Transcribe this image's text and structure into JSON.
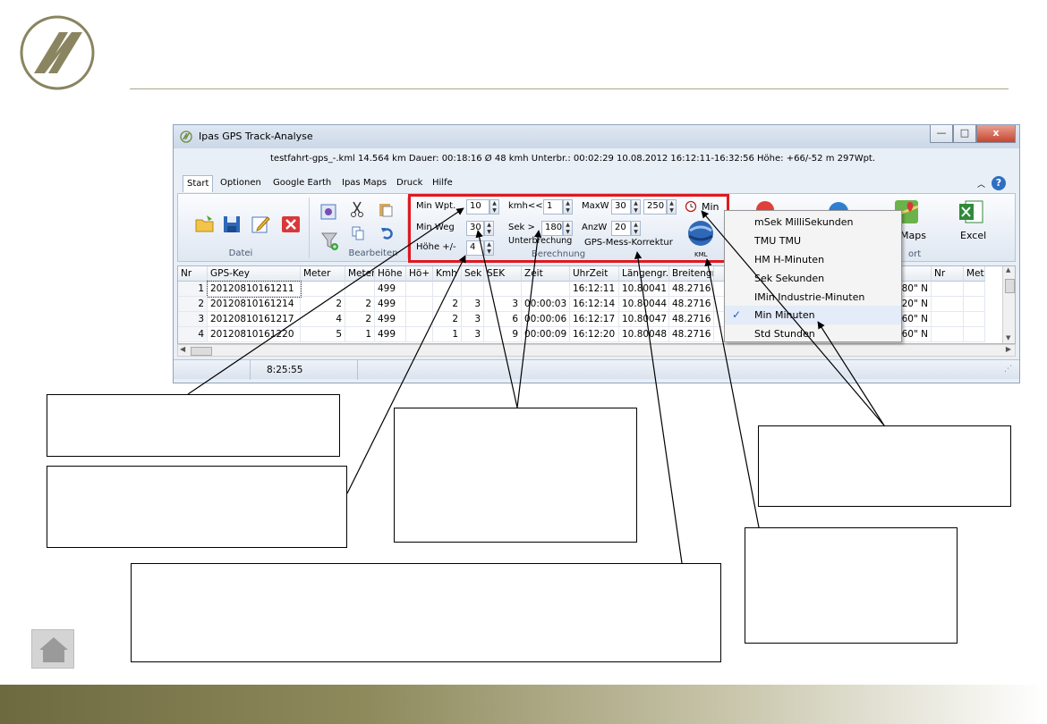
{
  "window": {
    "title": "Ipas GPS Track-Analyse",
    "info": "testfahrt-gps_-.kml 14.564 km  Dauer: 00:18:16  Ø 48 kmh  Unterbr.: 00:02:29  10.08.2012 16:12:11-16:32:56   Höhe: +66/-52 m  297Wpt.",
    "minimize": "—",
    "maximize": "□",
    "close": "x"
  },
  "tabs": [
    "Start",
    "Optionen",
    "Google Earth",
    "Ipas Maps",
    "Druck",
    "Hilfe"
  ],
  "ribbon": {
    "datei_label": "Datei",
    "bearbeiten_label": "Bearbeiten",
    "berechnung_label": "Berechnung",
    "export_label": "ort",
    "kml_label": "KML",
    "maps_label": "Maps",
    "excel_label": "Excel",
    "min_wpt_label": "Min Wpt.",
    "min_wpt_value": "10",
    "min_weg_label": "Min Weg",
    "min_weg_value": "30",
    "hoehe_label": "Höhe +/-",
    "hoehe_value": "4",
    "kmh_label": "kmh<<",
    "kmh_value": "1",
    "sek_label": "Sek >",
    "sek_value": "180",
    "unterbrechung_label": "Unterbrechung",
    "maxw_label": "MaxW",
    "maxw_value1": "30",
    "maxw_value2": "250",
    "anzw_label": "AnzW",
    "anzw_value": "20",
    "korrektur_label": "GPS-Mess-Korrektur",
    "min_unit_label": "Min"
  },
  "grid": {
    "headers": [
      "Nr",
      "GPS-Key",
      "Meter",
      "Meter",
      "Höhe",
      "Hö+",
      "Kmh",
      "Sek",
      "SEK",
      "Zeit",
      "UhrZeit",
      "Längengr.",
      "Breitengr",
      "Nr",
      "Met"
    ],
    "rows": [
      {
        "nr": "1",
        "key": "20120810161211",
        "meter": "",
        "meter2": "",
        "hoehe": "499",
        "hoplus": "",
        "kmh": "",
        "sek": "",
        "sek2": "",
        "zeit": "",
        "uhr": "16:12:11",
        "laenge": "10.80041",
        "breite": "48.2716",
        "breite_end": "680\" N"
      },
      {
        "nr": "2",
        "key": "20120810161214",
        "meter": "2",
        "meter2": "2",
        "hoehe": "499",
        "hoplus": "",
        "kmh": "2",
        "sek": "3",
        "sek2": "3",
        "zeit": "00:00:03",
        "uhr": "16:12:14",
        "laenge": "10.80044",
        "breite": "48.2716",
        "breite_end": "820\" N"
      },
      {
        "nr": "3",
        "key": "20120810161217",
        "meter": "4",
        "meter2": "2",
        "hoehe": "499",
        "hoplus": "",
        "kmh": "2",
        "sek": "3",
        "sek2": "6",
        "zeit": "00:00:06",
        "uhr": "16:12:17",
        "laenge": "10.80047",
        "breite": "48.2716",
        "breite_end": "960\" N"
      },
      {
        "nr": "4",
        "key": "20120810161220",
        "meter": "5",
        "meter2": "1",
        "hoehe": "499",
        "hoplus": "",
        "kmh": "1",
        "sek": "3",
        "sek2": "9",
        "zeit": "00:00:09",
        "uhr": "16:12:20",
        "laenge": "10.80048",
        "breite": "48.2716",
        "breite_end": "960\" N"
      }
    ]
  },
  "status": {
    "time": "8:25:55"
  },
  "menu": {
    "items": [
      {
        "label": "mSek MilliSekunden",
        "checked": false
      },
      {
        "label": "TMU  TMU",
        "checked": false
      },
      {
        "label": "HM   H-Minuten",
        "checked": false
      },
      {
        "label": "Sek  Sekunden",
        "checked": false
      },
      {
        "label": "IMin Industrie-Minuten",
        "checked": false
      },
      {
        "label": "Min  Minuten",
        "checked": true
      },
      {
        "label": "Std  Stunden",
        "checked": false
      }
    ],
    "check_mark": "✓"
  },
  "colors": {
    "highlight_box": "#e01820",
    "logo": "#8a8560",
    "bottom_bar": "#6e6a40"
  }
}
